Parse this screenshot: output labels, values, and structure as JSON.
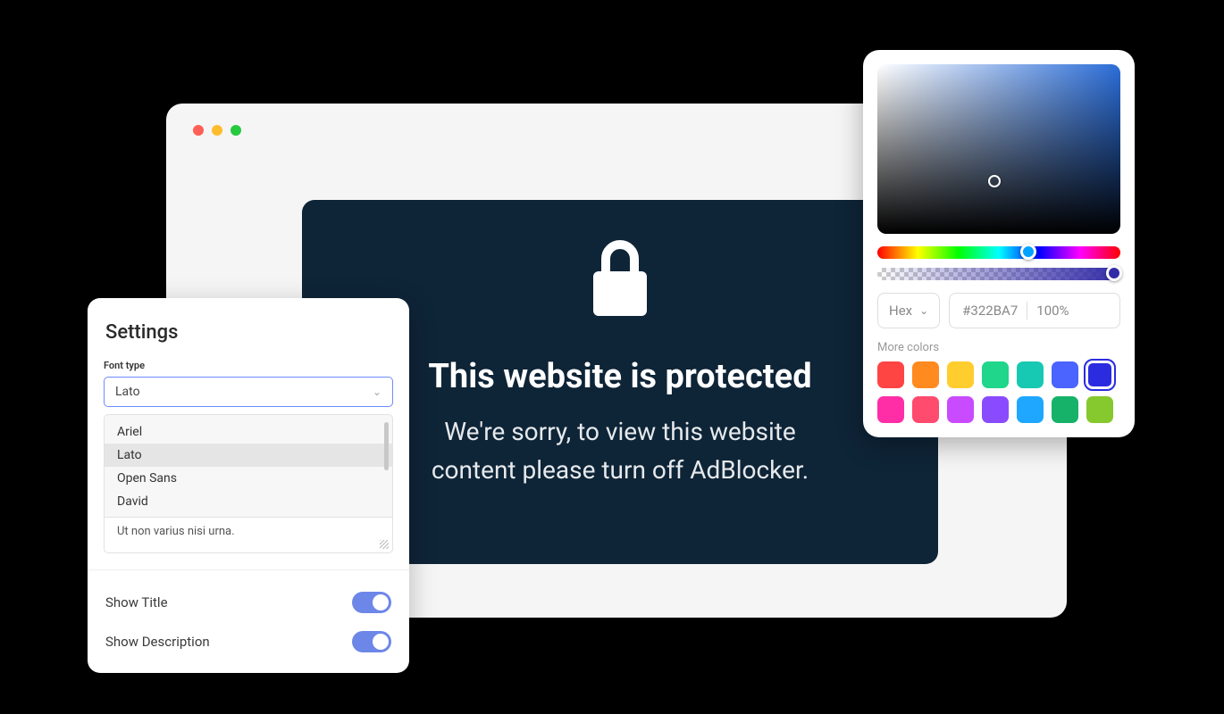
{
  "protected": {
    "title": "This website is protected",
    "line1": "We're sorry, to view this website",
    "line2": "content please turn off AdBlocker."
  },
  "settings": {
    "title": "Settings",
    "font_type_label": "Font type",
    "font_selected": "Lato",
    "font_options": [
      "Ariel",
      "Lato",
      "Open Sans",
      "David"
    ],
    "textarea_value": "Ut non varius nisi urna.",
    "show_title_label": "Show Title",
    "show_description_label": "Show Description",
    "show_title_on": true,
    "show_description_on": true
  },
  "colorpicker": {
    "format": "Hex",
    "hex": "#322BA7",
    "alpha": "100%",
    "more_label": "More colors",
    "swatches": [
      "#ff4444",
      "#ff8a1f",
      "#ffce2e",
      "#1fd68a",
      "#17c9b2",
      "#4b63ff",
      "#2b2be0",
      "#ff2ea6",
      "#ff4b6e",
      "#c94bff",
      "#8a4bff",
      "#1fa7ff",
      "#17b26a",
      "#86c92e"
    ],
    "selected_swatch_index": 6
  }
}
